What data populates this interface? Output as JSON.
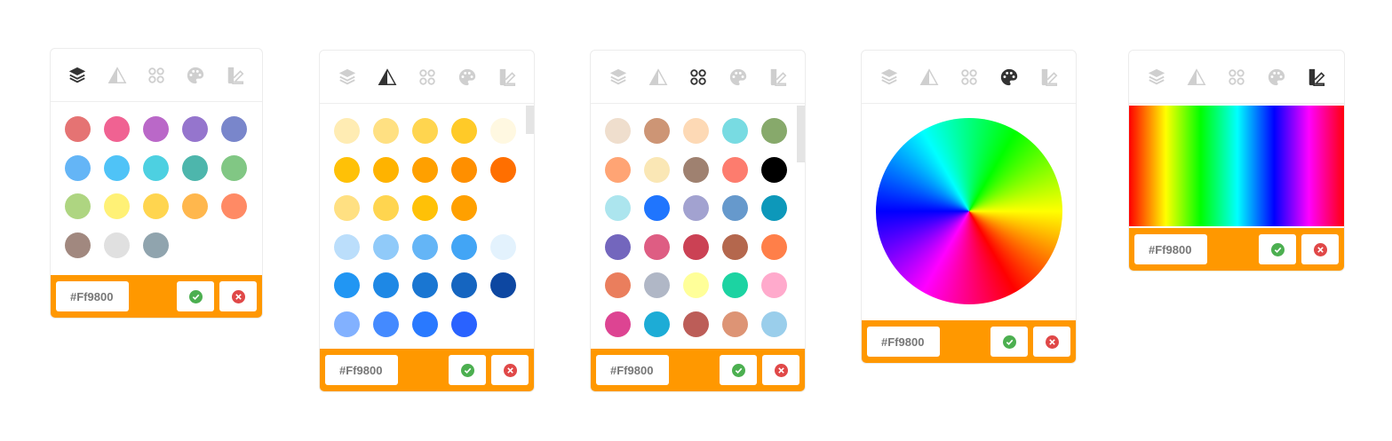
{
  "hex_value": "#Ff9800",
  "colors": {
    "accent": "#ff9800",
    "tab_active": "#333333",
    "tab_inactive": "#cfcfcf",
    "confirm": "#4caf50",
    "cancel": "#e04848"
  },
  "tab_icons": [
    "layers-icon",
    "triangle-icon",
    "circles-icon",
    "palette-icon",
    "custom-swatch-icon"
  ],
  "panels": [
    {
      "id": "material",
      "active_tab": 0,
      "rows": [
        [
          "#e57373",
          "#f06292",
          "#ba68c8",
          "#9575cd",
          "#7986cb"
        ],
        [
          "#64b5f6",
          "#4fc3f7",
          "#4dd0e1",
          "#4db6ac",
          "#81c784"
        ],
        [
          "#aed581",
          "#fff176",
          "#ffd54f",
          "#ffb74d",
          "#ff8a65"
        ],
        [
          "#a1887f",
          "#e0e0e0",
          "#90a4ae"
        ]
      ]
    },
    {
      "id": "shades",
      "active_tab": 1,
      "rows": [
        [
          "#ffecb3",
          "#ffe082",
          "#ffd54f",
          "#ffca28",
          "#fff8e1"
        ],
        [
          "#ffc107",
          "#ffb300",
          "#ffa000",
          "#ff8f00",
          "#ff6f00"
        ],
        [
          "#ffe082",
          "#ffd54f",
          "#ffc107",
          "#ffa000"
        ],
        [
          "#bbdefb",
          "#90caf9",
          "#64b5f6",
          "#42a5f5",
          "#e3f2fd"
        ],
        [
          "#2196f3",
          "#1e88e5",
          "#1976d2",
          "#1565c0",
          "#0d47a1"
        ],
        [
          "#82b1ff",
          "#448aff",
          "#2979ff",
          "#2962ff"
        ]
      ]
    },
    {
      "id": "custom-set",
      "active_tab": 2,
      "rows": [
        [
          "#efdecd",
          "#cd9575",
          "#fdd9b5",
          "#78dbe2",
          "#87a96b"
        ],
        [
          "#ffa474",
          "#fae7b5",
          "#9f8170",
          "#fd7c6e",
          "#000000"
        ],
        [
          "#ace5ee",
          "#1f75fe",
          "#a2a2d0",
          "#6699cc",
          "#0d98ba"
        ],
        [
          "#7366bd",
          "#de5d83",
          "#cb4154",
          "#b4674d",
          "#ff7f49"
        ],
        [
          "#ea7e5d",
          "#b0b7c6",
          "#ffff99",
          "#1cd3a2",
          "#ffaacc"
        ],
        [
          "#dd4492",
          "#1dacd6",
          "#bc5d58",
          "#dd9475",
          "#9aceeb"
        ]
      ]
    },
    {
      "id": "wheel",
      "active_tab": 3
    },
    {
      "id": "spectrum",
      "active_tab": 4
    }
  ]
}
